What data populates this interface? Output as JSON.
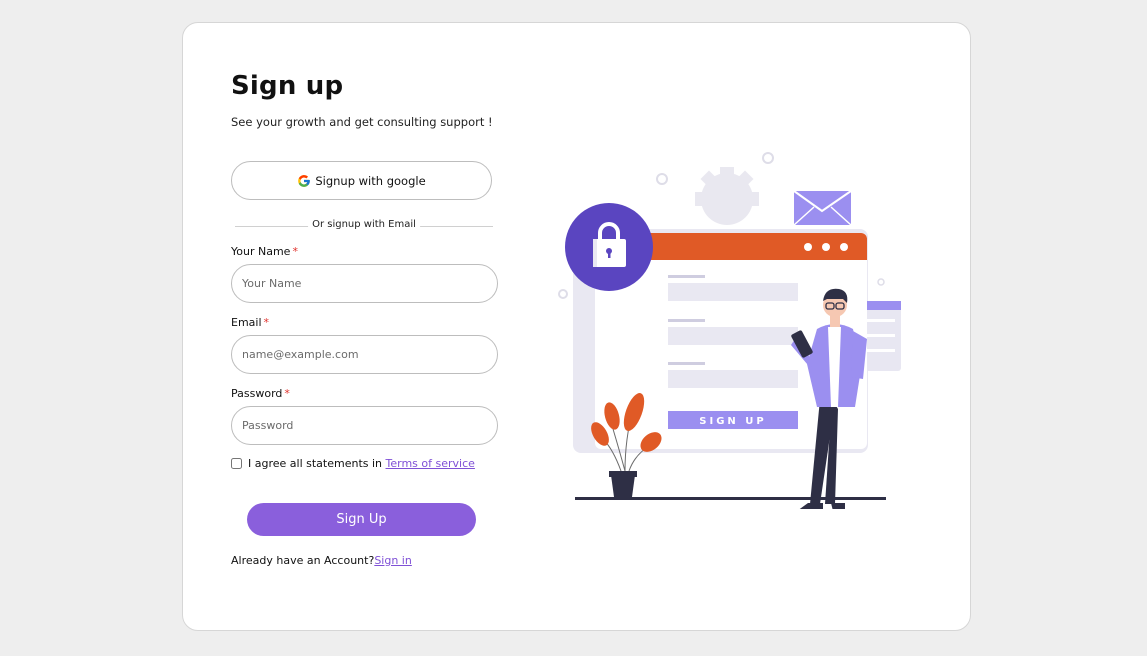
{
  "signup": {
    "title": "Sign up",
    "subtitle": "See your growth and get consulting support !",
    "google_label": "Signup with google",
    "divider_text": "Or signup with Email",
    "name_label": "Your Name",
    "name_placeholder": "Your Name",
    "email_label": "Email",
    "email_placeholder": "name@example.com",
    "password_label": "Password",
    "password_placeholder": "Password",
    "required_mark": "*",
    "agree_text": "I agree all statements in",
    "terms_link": "Terms of service",
    "submit_label": "Sign Up",
    "account_text": "Already have an Account?",
    "signin_link": "Sign in"
  },
  "illustration": {
    "button_text": "SIGN UP",
    "icons": [
      "lock-icon",
      "envelope-icon",
      "gear-icon",
      "plant-icon"
    ]
  },
  "colors": {
    "accent": "#8a5fdc",
    "browser_bar": "#e05a26",
    "lock_circle": "#5a45c0",
    "illustration_purple": "#9b8ff0",
    "leaf": "#e05a26",
    "required": "#e0312b",
    "link": "#7f50d6"
  }
}
